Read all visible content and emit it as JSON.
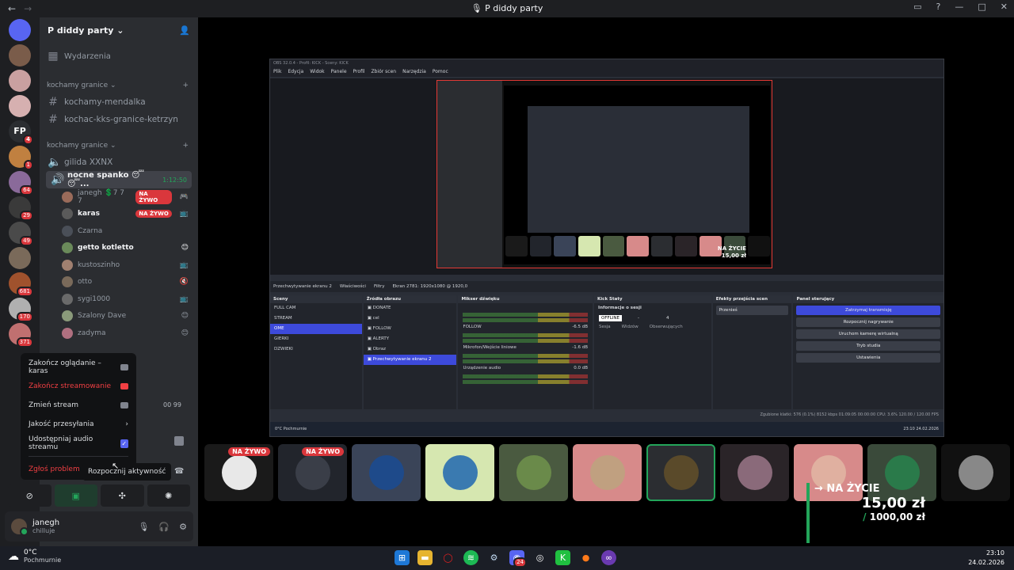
{
  "window": {
    "title": "P diddy party"
  },
  "guilds": [
    {
      "color": "#5865f2",
      "badge": ""
    },
    {
      "color": "#7a5c4a",
      "badge": ""
    },
    {
      "color": "#c9a0a0",
      "badge": ""
    },
    {
      "color": "#d6b0b0",
      "badge": ""
    },
    {
      "color": "#2b2d31",
      "badge": "4",
      "label": "FP"
    },
    {
      "color": "#c08040",
      "badge": "1"
    },
    {
      "color": "#8a6a9a",
      "badge": "64"
    },
    {
      "color": "#3a3a3a",
      "badge": "29"
    },
    {
      "color": "#4a4a4a",
      "badge": "49"
    },
    {
      "color": "#7a6a5a",
      "badge": ""
    },
    {
      "color": "#a0522d",
      "badge": "681"
    },
    {
      "color": "#b0b0b0",
      "badge": "170"
    },
    {
      "color": "#c07070",
      "badge": "371"
    }
  ],
  "server": {
    "name": "P diddy party",
    "events": "Wydarzenia",
    "categories": [
      {
        "name": "kochamy granice",
        "channels": [
          "kochamy-mendalka",
          "kochac-kks-granice-ketrzyn"
        ]
      },
      {
        "name": "kochamy granice",
        "channels": [
          "gilida XXNX"
        ]
      }
    ],
    "active_voice": {
      "name": "nocne spanko 😴😴...",
      "time": "1:12:50"
    },
    "voice_users": [
      {
        "name": "janegh 💲7 7 7",
        "live": "NA ŻYWO",
        "icon": "🎮",
        "color": "#9a6b5a",
        "bold": false
      },
      {
        "name": "karas",
        "live": "NA ŻYWO",
        "icon": "📺",
        "color": "#5a5a5a",
        "bold": true
      },
      {
        "name": "Czarna",
        "live": "",
        "icon": "",
        "color": "#4a4f58",
        "bold": false
      },
      {
        "name": "getto kotletto",
        "live": "",
        "icon": "😊",
        "color": "#6a8a5a",
        "bold": true
      },
      {
        "name": "kustoszinho",
        "live": "",
        "icon": "📺",
        "color": "#a08070",
        "bold": false
      },
      {
        "name": "otto",
        "live": "",
        "icon": "🔇",
        "color": "#7a6a5a",
        "bold": false
      },
      {
        "name": "sygi1000",
        "live": "",
        "icon": "📺",
        "color": "#6a6a6a",
        "bold": false
      },
      {
        "name": "Szalony Dave",
        "live": "",
        "icon": "😊",
        "color": "#8a9a7a",
        "bold": false
      },
      {
        "name": "zadyma",
        "live": "",
        "icon": "😊",
        "color": "#b07080",
        "bold": false
      }
    ]
  },
  "context_menu": {
    "items": [
      {
        "label": "Zakończ oglądanie – karas",
        "red": false
      },
      {
        "label": "Zakończ streamowanie",
        "red": true
      },
      {
        "label": "Zmień stream",
        "red": false
      },
      {
        "label": "Jakość przesyłania",
        "red": false
      },
      {
        "label": "Udostępniaj audio streamu",
        "red": false
      }
    ],
    "report": "Zgłoś problem",
    "tooltip": "Rozpocznij aktywność",
    "counts": "00  99"
  },
  "user": {
    "name": "janegh",
    "status": "chilluje"
  },
  "obs": {
    "title": "OBS 32.0.4 - Profil: KICK - Sceny: KICK",
    "menu": [
      "Plik",
      "Edycja",
      "Widok",
      "Panele",
      "Profil",
      "Zbiór scen",
      "Narzędzia",
      "Pomoc"
    ],
    "source_bar": [
      "Przechwytywanie ekranu 2",
      "Właściwości",
      "Filtry",
      "Ekran  2781: 1920x1080 @ 1920,0"
    ],
    "scenes_title": "Sceny",
    "scenes": [
      "FULL CAM",
      "STREAM",
      "OME",
      "GIERKI",
      "DZWIEKI"
    ],
    "sources_title": "Źródła obrazu",
    "sources": [
      "DONATE",
      "cel",
      "FOLLOW",
      "ALERTY",
      "Obraz",
      "Przechwytywanie ekranu 2"
    ],
    "mixer_title": "Mikser dźwięku",
    "mixer": [
      {
        "name": "",
        "db": ""
      },
      {
        "name": "FOLLOW",
        "db": "-6.5 dB"
      },
      {
        "name": "Mikrofon/Wejście liniowe",
        "db": "-1.6 dB"
      },
      {
        "name": "Urządzenie audio",
        "db": "0.0 dB"
      }
    ],
    "kick_title": "Kick Staty",
    "kick_info": "Informacje o sesji",
    "kick_status": "OFFLINE",
    "kick_dash": "-",
    "kick_viewers": "4",
    "kick_labels": [
      "Sesja",
      "Widzów",
      "Obserwujących"
    ],
    "transitions_title": "Efekty przejścia scen",
    "transition": "Przenieś",
    "controls_title": "Panel sterujący",
    "controls": [
      "Zatrzymaj transmisję",
      "Rozpocznij nagrywanie",
      "Uruchom kamerę wirtualną",
      "Tryb studia",
      "Ustawienia"
    ],
    "status": "Zgubione klatki: 576 (0.1%)   8152 kbps   01:09:05   00:00:00   CPU: 3.6%   120.00 / 120.00 FPS",
    "taskbar_weather": "0°C Pochmurnie",
    "taskbar_clock": "23:10 24.02.2026",
    "inner_live_line1": "NA ŻYCIE",
    "inner_live_line2": "15,00 zł"
  },
  "tiles": [
    {
      "live": "NA ŻYWO",
      "color": "#1a1a1a",
      "face": "#e8e8e8",
      "speaking": false
    },
    {
      "live": "NA ŻYWO",
      "color": "#22252c",
      "face": "#3a3e48",
      "speaking": false
    },
    {
      "live": "",
      "color": "#3a4458",
      "face": "#1e4a8a",
      "speaking": false
    },
    {
      "live": "",
      "color": "#d6e7b0",
      "face": "#3a7ab0",
      "speaking": false
    },
    {
      "live": "",
      "color": "#4a5a40",
      "face": "#6a8a4a",
      "speaking": false
    },
    {
      "live": "",
      "color": "#d78a8a",
      "face": "#c0a080",
      "speaking": false
    },
    {
      "live": "",
      "color": "#2b2d31",
      "face": "#5a4a2a",
      "speaking": true
    },
    {
      "live": "",
      "color": "#2a2428",
      "face": "#8a6a7a",
      "speaking": false
    },
    {
      "live": "",
      "color": "#d78a8a",
      "face": "#e0b0a0",
      "speaking": false
    },
    {
      "live": "",
      "color": "#3a4a3a",
      "face": "#2a7a4a",
      "speaking": false
    },
    {
      "live": "",
      "color": "#111111",
      "face": "#888888",
      "speaking": false
    }
  ],
  "overlay": {
    "line1": "→ NA ŻYCIE",
    "line2": "15,00 zł",
    "line3_prefix": "/",
    "line3": "1000,00 zł"
  },
  "taskbar": {
    "temp": "0°C",
    "weather": "Pochmurnie",
    "time": "23:10",
    "date": "24.02.2026",
    "discord_badge": "24"
  }
}
